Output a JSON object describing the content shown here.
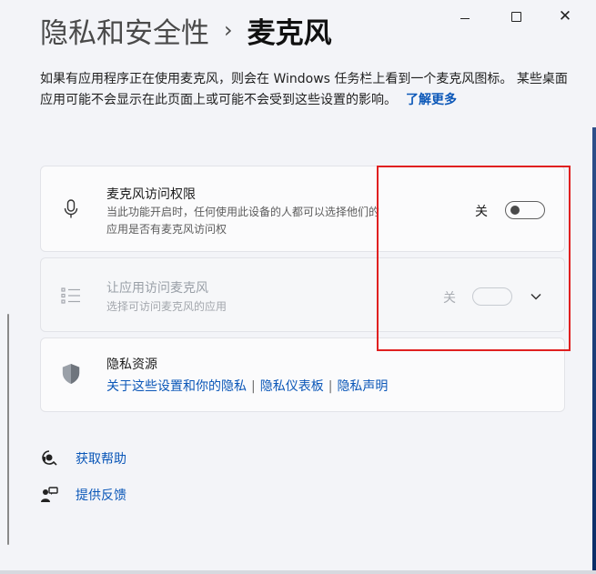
{
  "window": {
    "controls": {
      "minimize": "–",
      "maximize": "□",
      "close": "✕"
    }
  },
  "breadcrumb": {
    "parent": "隐私和安全性",
    "separator": "›",
    "current": "麦克风"
  },
  "description": {
    "text": "如果有应用程序正在使用麦克风，则会在 Windows 任务栏上看到一个麦克风图标。 某些桌面应用可能不会显示在此页面上或可能不会受到这些设置的影响。",
    "link": "了解更多"
  },
  "settings": {
    "mic_access": {
      "icon": "microphone-icon",
      "title": "麦克风访问权限",
      "subtitle": "当此功能开启时，任何使用此设备的人都可以选择他们的应用是否有麦克风访问权",
      "toggle_label": "关",
      "toggle_on": false
    },
    "app_access": {
      "icon": "list-icon",
      "title": "让应用访问麦克风",
      "subtitle": "选择可访问麦克风的应用",
      "toggle_label": "关",
      "toggle_on": false,
      "disabled": true
    },
    "privacy": {
      "icon": "shield-icon",
      "title": "隐私资源",
      "links": [
        "关于这些设置和你的隐私",
        "隐私仪表板",
        "隐私声明"
      ],
      "link_separator": "|"
    }
  },
  "help": {
    "get_help": "获取帮助",
    "feedback": "提供反馈"
  },
  "colors": {
    "accent": "#0b57b8",
    "highlight_box": "#e02020",
    "disabled_text": "#9aa0a8"
  }
}
